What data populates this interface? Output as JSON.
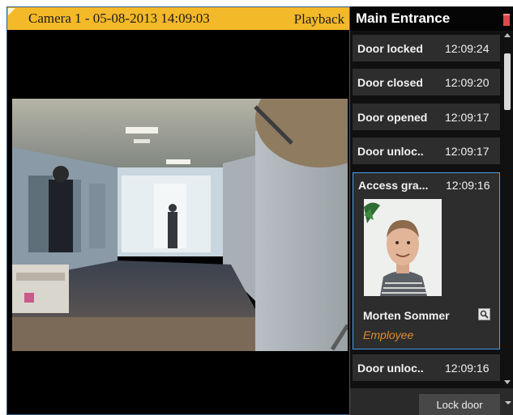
{
  "camera": {
    "title": "Camera 1 - 05-08-2013 14:09:03",
    "mode": "Playback"
  },
  "panel": {
    "title": "Main Entrance",
    "events": [
      {
        "type": "Door locked",
        "time": "12:09:24"
      },
      {
        "type": "Door closed",
        "time": "12:09:20"
      },
      {
        "type": "Door opened",
        "time": "12:09:17"
      },
      {
        "type": "Door unloc..",
        "time": "12:09:17"
      }
    ],
    "expanded_event": {
      "type": "Access gra...",
      "time": "12:09:16",
      "person_name": "Morten Sommer",
      "person_role": "Employee"
    },
    "after_events": [
      {
        "type": "Door unloc..",
        "time": "12:09:16"
      }
    ],
    "action_button": "Lock door"
  },
  "colors": {
    "header_accent": "#f4b928",
    "selection_border": "#4a9de6",
    "role_text": "#e08a2e"
  },
  "icons": [
    "corner-flag-icon",
    "status-indicator-icon",
    "search-icon",
    "scroll-up-icon",
    "scroll-down-icon",
    "dropdown-arrow-icon"
  ]
}
